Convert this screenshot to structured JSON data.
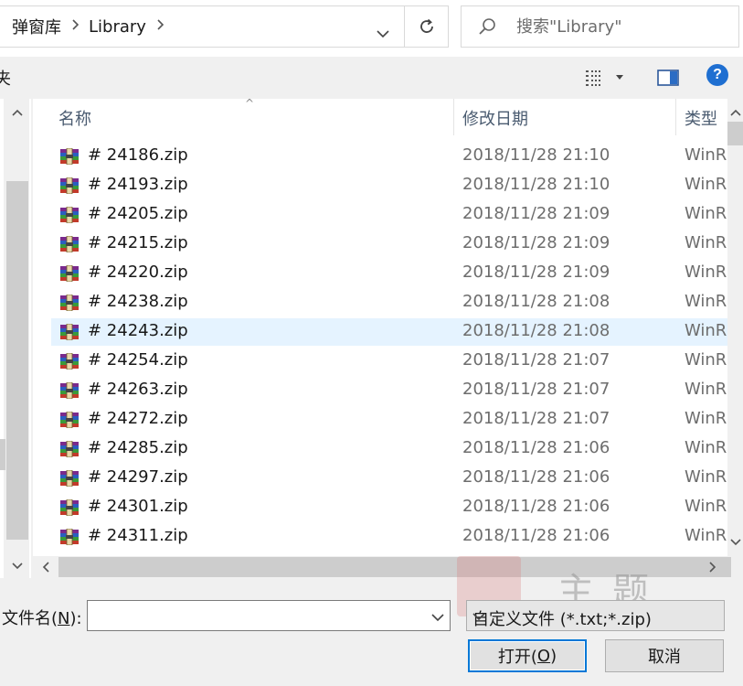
{
  "window": {
    "breadcrumb": [
      "弹窗库",
      "Library"
    ],
    "search": {
      "placeholder": "搜索\"Library\""
    }
  },
  "toolbar": {
    "left_text": "夹",
    "help_label": "?"
  },
  "list": {
    "columns": [
      "名称",
      "修改日期",
      "类型"
    ],
    "rows": [
      {
        "name": "# 24186.zip",
        "date": "2018/11/28 21:10",
        "type": "WinR"
      },
      {
        "name": "# 24193.zip",
        "date": "2018/11/28 21:10",
        "type": "WinR"
      },
      {
        "name": "# 24205.zip",
        "date": "2018/11/28 21:09",
        "type": "WinR"
      },
      {
        "name": "# 24215.zip",
        "date": "2018/11/28 21:09",
        "type": "WinR"
      },
      {
        "name": "# 24220.zip",
        "date": "2018/11/28 21:09",
        "type": "WinR"
      },
      {
        "name": "# 24238.zip",
        "date": "2018/11/28 21:08",
        "type": "WinR"
      },
      {
        "name": "# 24243.zip",
        "date": "2018/11/28 21:08",
        "type": "WinR",
        "selected": true
      },
      {
        "name": "# 24254.zip",
        "date": "2018/11/28 21:07",
        "type": "WinR"
      },
      {
        "name": "# 24263.zip",
        "date": "2018/11/28 21:07",
        "type": "WinR"
      },
      {
        "name": "# 24272.zip",
        "date": "2018/11/28 21:07",
        "type": "WinR"
      },
      {
        "name": "# 24285.zip",
        "date": "2018/11/28 21:06",
        "type": "WinR"
      },
      {
        "name": "# 24297.zip",
        "date": "2018/11/28 21:06",
        "type": "WinR"
      },
      {
        "name": "# 24301.zip",
        "date": "2018/11/28 21:06",
        "type": "WinR"
      },
      {
        "name": "# 24311.zip",
        "date": "2018/11/28 21:06",
        "type": "WinR"
      }
    ]
  },
  "form": {
    "filename_label_pre": "文件名(",
    "filename_label_key": "N",
    "filename_label_post": "):",
    "filename_value": "",
    "filetype_selected": "自定义文件 (*.txt;*.zip)",
    "open_pre": "打开(",
    "open_key": "O",
    "open_post": ")",
    "cancel_label": "取消"
  },
  "watermark": {
    "text": "主题"
  },
  "icons": {
    "file_icon": "winrar-archive-icon",
    "refresh": "refresh-icon",
    "search": "search-icon",
    "dropdown": "chevron-down-icon",
    "breadcrumb_sep": "chevron-right-icon",
    "view": "details-view-icon",
    "pane": "preview-pane-icon",
    "help": "help-icon"
  }
}
